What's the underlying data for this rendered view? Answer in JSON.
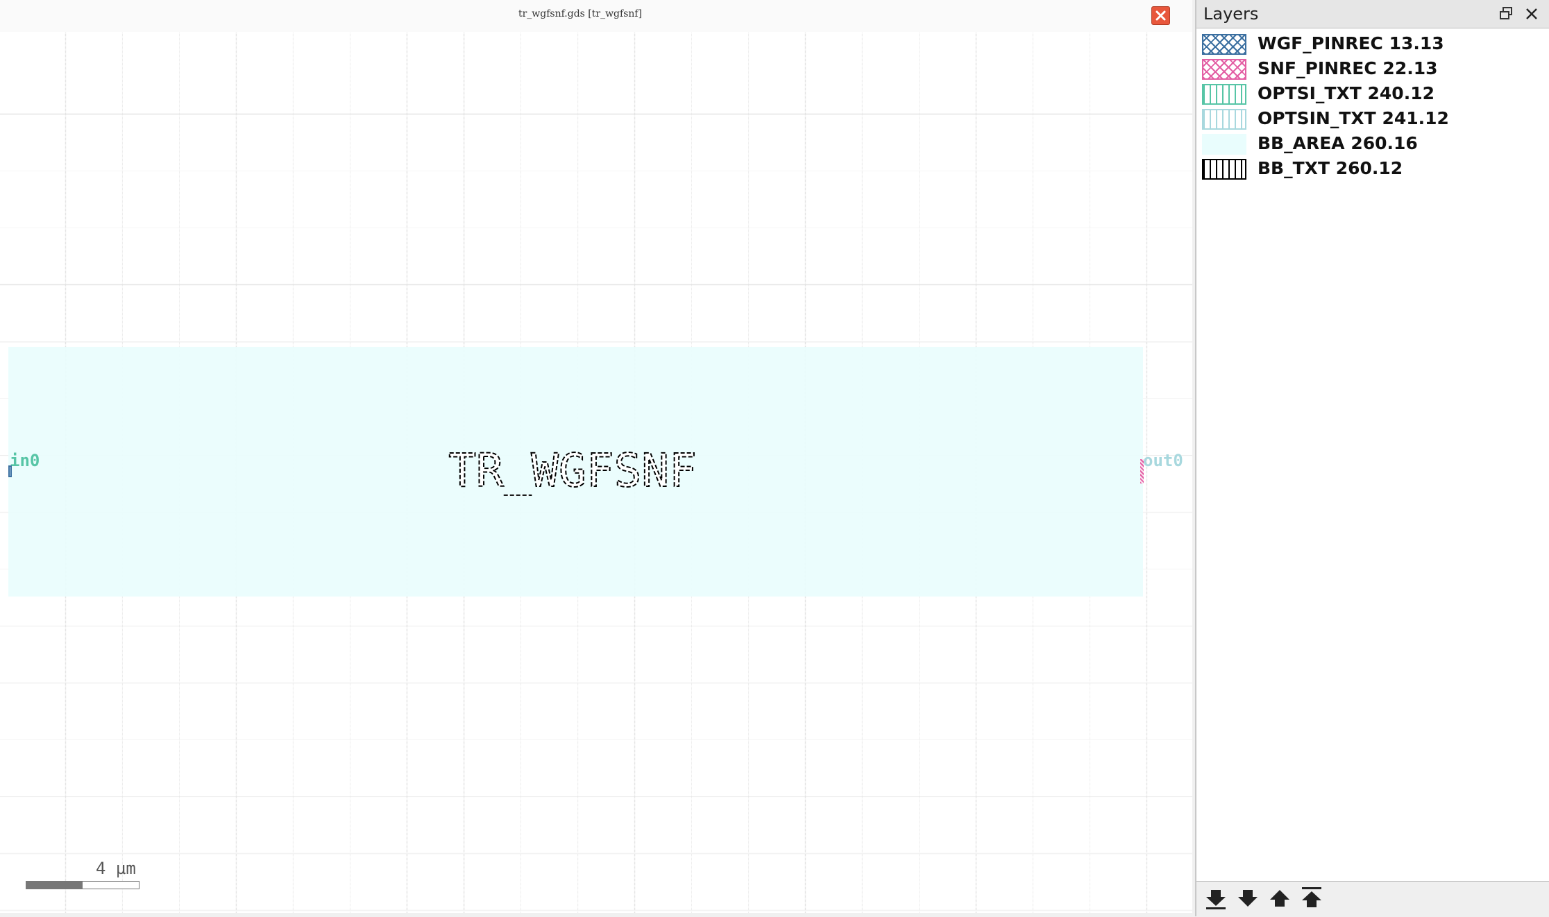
{
  "window": {
    "title": "tr_wgfsnf.gds [tr_wgfsnf]"
  },
  "canvas": {
    "cell_label": "TR_WGFSNF",
    "pin_in": "in0",
    "pin_out": "out0",
    "scale_label": "4 µm",
    "scale_fill_fraction": 0.5,
    "colors": {
      "bb_area": "#e9fdfd",
      "pin_in_text": "#57c5a6",
      "pin_out_text": "#a8d8de",
      "close_button": "#e8573c"
    }
  },
  "layers_panel": {
    "title": "Layers",
    "icons": [
      "float-icon",
      "close-icon"
    ],
    "layers": [
      {
        "label": "WGF_PINREC 13.13",
        "pattern": "crosshatch",
        "color": "#3b6fa0"
      },
      {
        "label": "SNF_PINREC 22.13",
        "pattern": "crosshatch",
        "color": "#e35fa4"
      },
      {
        "label": "OPTSI_TXT 240.12",
        "pattern": "vertical",
        "color": "#57c5a6"
      },
      {
        "label": "OPTSIN_TXT 241.12",
        "pattern": "vertical",
        "color": "#a8d8de"
      },
      {
        "label": "BB_AREA 260.16",
        "pattern": "solid",
        "color": "#e9fdfd"
      },
      {
        "label": "BB_TXT 260.12",
        "pattern": "vertical",
        "color": "#000000"
      }
    ],
    "bottom_buttons": [
      "move-to-bottom-icon",
      "move-down-icon",
      "move-up-icon",
      "move-to-top-icon"
    ]
  }
}
